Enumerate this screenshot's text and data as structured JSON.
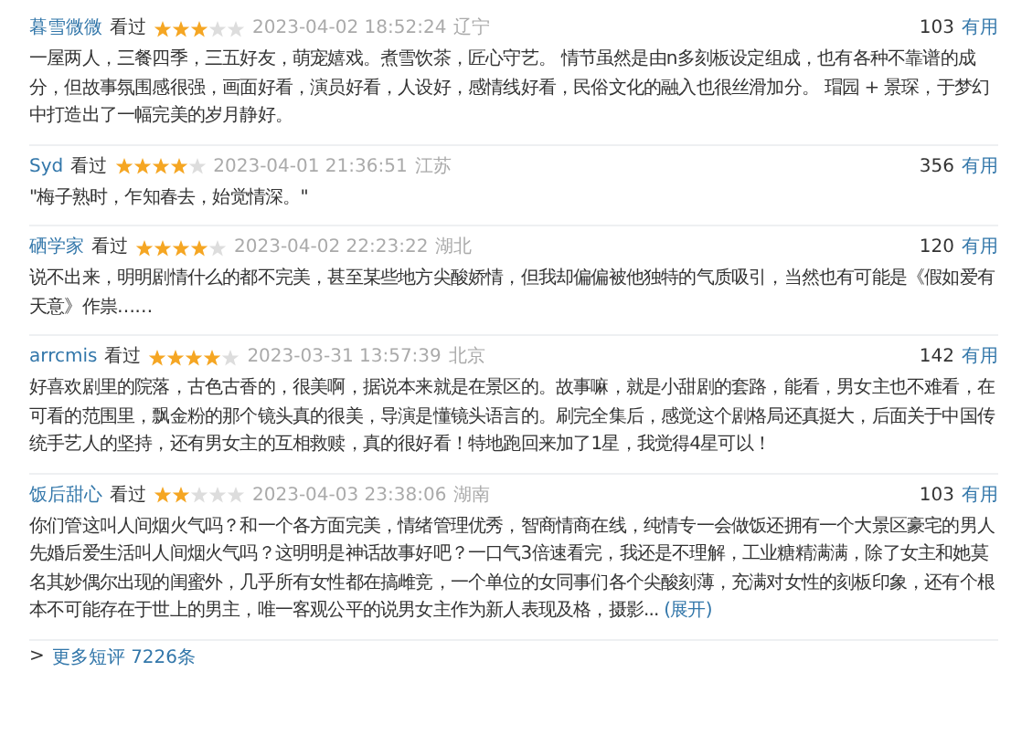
{
  "reviews": [
    {
      "user": "暮雪微微",
      "status": "看过",
      "stars": 3,
      "time": "2023-04-02 18:52:24",
      "location": "辽宁",
      "votes": "103",
      "vote_label": "有用",
      "text": "一屋两人，三餐四季，三五好友，萌宠嬉戏。煮雪饮茶，匠心守艺。 情节虽然是由n多刻板设定组成，也有各种不靠谱的成分，但故事氛围感很强，画面好看，演员好看，人设好，感情线好看，民俗文化的融入也很丝滑加分。 瑁园 + 景琛，于梦幻中打造出了一幅完美的岁月静好。"
    },
    {
      "user": "Syd",
      "status": "看过",
      "stars": 4,
      "time": "2023-04-01 21:36:51",
      "location": "江苏",
      "votes": "356",
      "vote_label": "有用",
      "text": "\"梅子熟时，乍知春去，始觉情深。\""
    },
    {
      "user": "硒学家",
      "status": "看过",
      "stars": 4,
      "time": "2023-04-02 22:23:22",
      "location": "湖北",
      "votes": "120",
      "vote_label": "有用",
      "text": "说不出来，明明剧情什么的都不完美，甚至某些地方尖酸娇情，但我却偏偏被他独特的气质吸引，当然也有可能是《假如爱有天意》作祟……"
    },
    {
      "user": "arrcmis",
      "status": "看过",
      "stars": 4,
      "time": "2023-03-31 13:57:39",
      "location": "北京",
      "votes": "142",
      "vote_label": "有用",
      "text": "好喜欢剧里的院落，古色古香的，很美啊，据说本来就是在景区的。故事嘛，就是小甜剧的套路，能看，男女主也不难看，在可看的范围里，飘金粉的那个镜头真的很美，导演是懂镜头语言的。刷完全集后，感觉这个剧格局还真挺大，后面关于中国传统手艺人的坚持，还有男女主的互相救赎，真的很好看！特地跑回来加了1星，我觉得4星可以！"
    },
    {
      "user": "饭后甜心",
      "status": "看过",
      "stars": 2,
      "time": "2023-04-03 23:38:06",
      "location": "湖南",
      "votes": "103",
      "vote_label": "有用",
      "text": "你们管这叫人间烟火气吗？和一个各方面完美，情绪管理优秀，智商情商在线，纯情专一会做饭还拥有一个大景区豪宅的男人先婚后爱生活叫人间烟火气吗？这明明是神话故事好吧？一口气3倍速看完，我还是不理解，工业糖精满满，除了女主和她莫名其妙偶尔出现的闺蜜外，几乎所有女性都在搞雌竞，一个单位的女同事们各个尖酸刻薄，充满对女性的刻板印象，还有个根本不可能存在于世上的男主，唯一客观公平的说男女主作为新人表现及格，摄影...",
      "expand": "(展开)"
    }
  ],
  "more": {
    "arrow": ">",
    "label": "更多短评 7226条"
  }
}
